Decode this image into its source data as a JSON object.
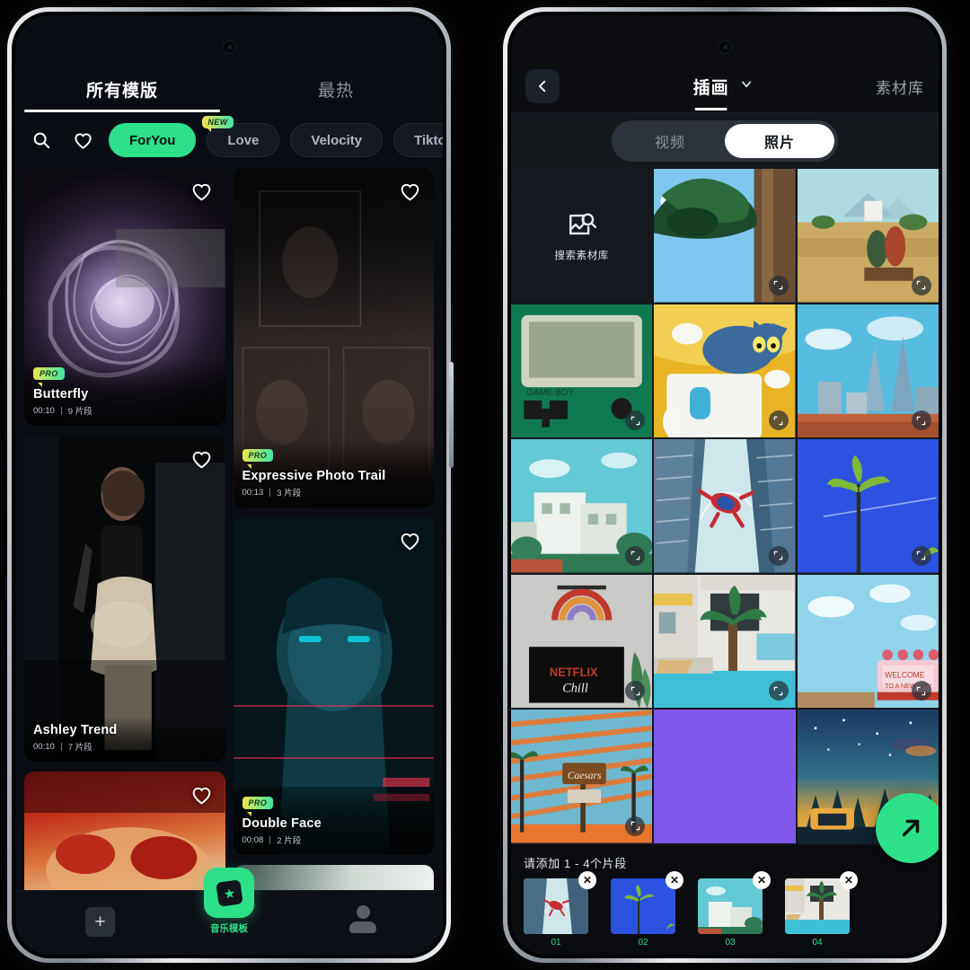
{
  "left_phone": {
    "tabs": [
      {
        "label": "所有模版",
        "active": true
      },
      {
        "label": "最热",
        "active": false
      }
    ],
    "search_icon": "search-icon",
    "favorite_icon": "heart-icon",
    "chips": [
      {
        "label": "ForYou",
        "active": true,
        "badge": null
      },
      {
        "label": "Love",
        "active": false,
        "badge": "NEW"
      },
      {
        "label": "Velocity",
        "active": false,
        "badge": null
      },
      {
        "label": "Tiktok",
        "active": false,
        "badge": null
      }
    ],
    "templates": [
      {
        "name": "Butterfly",
        "duration": "00:10",
        "clips": "9 片段",
        "pro": "PRO",
        "col": "left"
      },
      {
        "name": "Expressive Photo Trail",
        "duration": "00:13",
        "clips": "3 片段",
        "pro": "PRO",
        "col": "right"
      },
      {
        "name": "Ashley Trend",
        "duration": "00:10",
        "clips": "7 片段",
        "pro": "",
        "col": "left"
      },
      {
        "name": "Double Face",
        "duration": "00:08",
        "clips": "2 片段",
        "pro": "PRO",
        "col": "right"
      }
    ],
    "bottom_nav": {
      "add_label": "+",
      "center_label": "音乐模板",
      "profile_icon": "person-icon"
    },
    "accent_color": "#2DE08A"
  },
  "right_phone": {
    "header": {
      "back_icon": "chevron-left-icon",
      "title": "插画",
      "dropdown_icon": "chevron-down-icon",
      "right_label": "素材库"
    },
    "segmented": [
      {
        "label": "视频",
        "active": false
      },
      {
        "label": "照片",
        "active": true
      }
    ],
    "search_cell": {
      "label": "搜索素材库",
      "icon": "image-search-icon"
    },
    "grid_expand_icon": "expand-icon",
    "tray": {
      "title": "请添加 1 - 4个片段",
      "items": [
        {
          "num": "01",
          "remove_icon": "close-icon"
        },
        {
          "num": "02",
          "remove_icon": "close-icon"
        },
        {
          "num": "03",
          "remove_icon": "close-icon"
        },
        {
          "num": "04",
          "remove_icon": "close-icon"
        }
      ]
    },
    "fab_icon": "arrow-up-right-icon",
    "accent_color": "#2DE08A"
  }
}
